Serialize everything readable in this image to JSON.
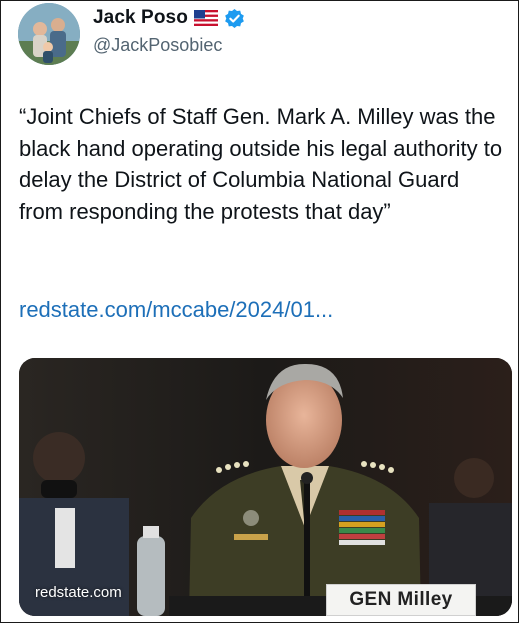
{
  "author": {
    "name": "Jack Poso",
    "flag_icon": "us-flag-icon",
    "verified_icon": "verified-badge-icon",
    "handle": "@JackPosobiec",
    "verified_color": "#1d9bf0"
  },
  "tweet": {
    "text": "“Joint Chiefs of Staff Gen. Mark A. Milley was the black hand operating outside his legal authority to delay the District of Columbia National Guard from responding the protests that day”",
    "link": "redstate.com/mccabe/2024/01...",
    "link_color": "#1d6fb8"
  },
  "media": {
    "source_label": "redstate.com",
    "nameplate": "GEN Milley"
  }
}
